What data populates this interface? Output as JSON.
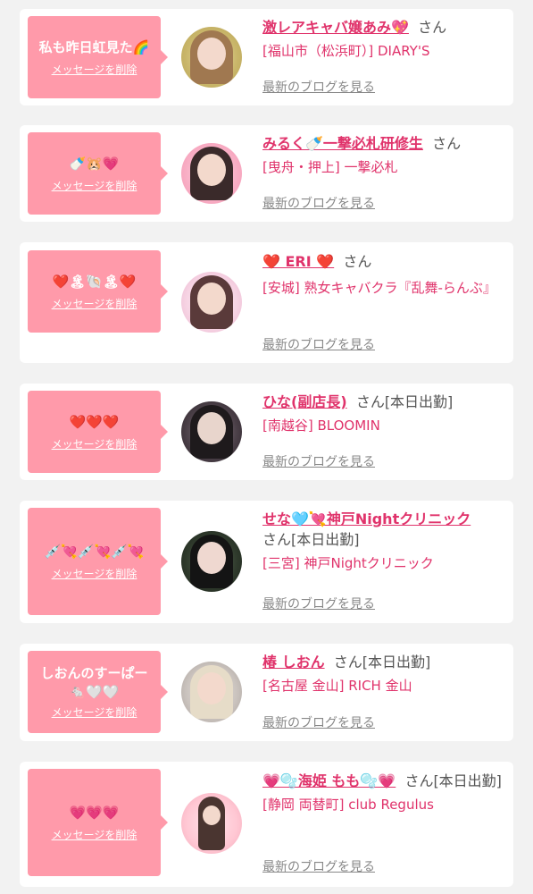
{
  "delete_label": "メッセージを削除",
  "blog_label": "最新のブログを見る",
  "colors": {
    "accent": "#e0336b",
    "bubble": "#ff9aaa"
  },
  "items": [
    {
      "message": "私も昨日虹見た🌈",
      "name": "激レアキャバ嬢あみ💖",
      "suffix": "さん",
      "shop": "[福山市（松浜町）] DIARY'S"
    },
    {
      "message": "🍼🐹💗",
      "name": "みるく🍼一撃必札研修生",
      "suffix": "さん",
      "shop": "[曳舟・押上] 一撃必札"
    },
    {
      "message": "❤️🏝🐚🏝❤️",
      "name": "❤️ ERI ❤️",
      "suffix": "さん",
      "shop": "[安城] 熟女キャバクラ『乱舞-らんぶ』"
    },
    {
      "message": "❤️❤️❤️",
      "name": "ひな(副店長)",
      "suffix": "さん[本日出勤]",
      "shop": "[南越谷] BLOOMIN"
    },
    {
      "message": "💉💘💉💘💉💘",
      "name": "せな🩵💘神戸Nightクリニック",
      "suffix": "さん[本日出勤]",
      "shop": "[三宮] 神戸Nightクリニック"
    },
    {
      "message": "しおんのすーぱー",
      "message2": "🐁🤍🤍",
      "name": "椿 しおん",
      "suffix": "さん[本日出勤]",
      "shop": "[名古屋 金山] RICH 金山"
    },
    {
      "message": "💗💗💗",
      "name": "💗🫧海姫 もも🫧💗",
      "suffix": "さん[本日出勤]",
      "shop": "[静岡 両替町] club Regulus"
    }
  ]
}
